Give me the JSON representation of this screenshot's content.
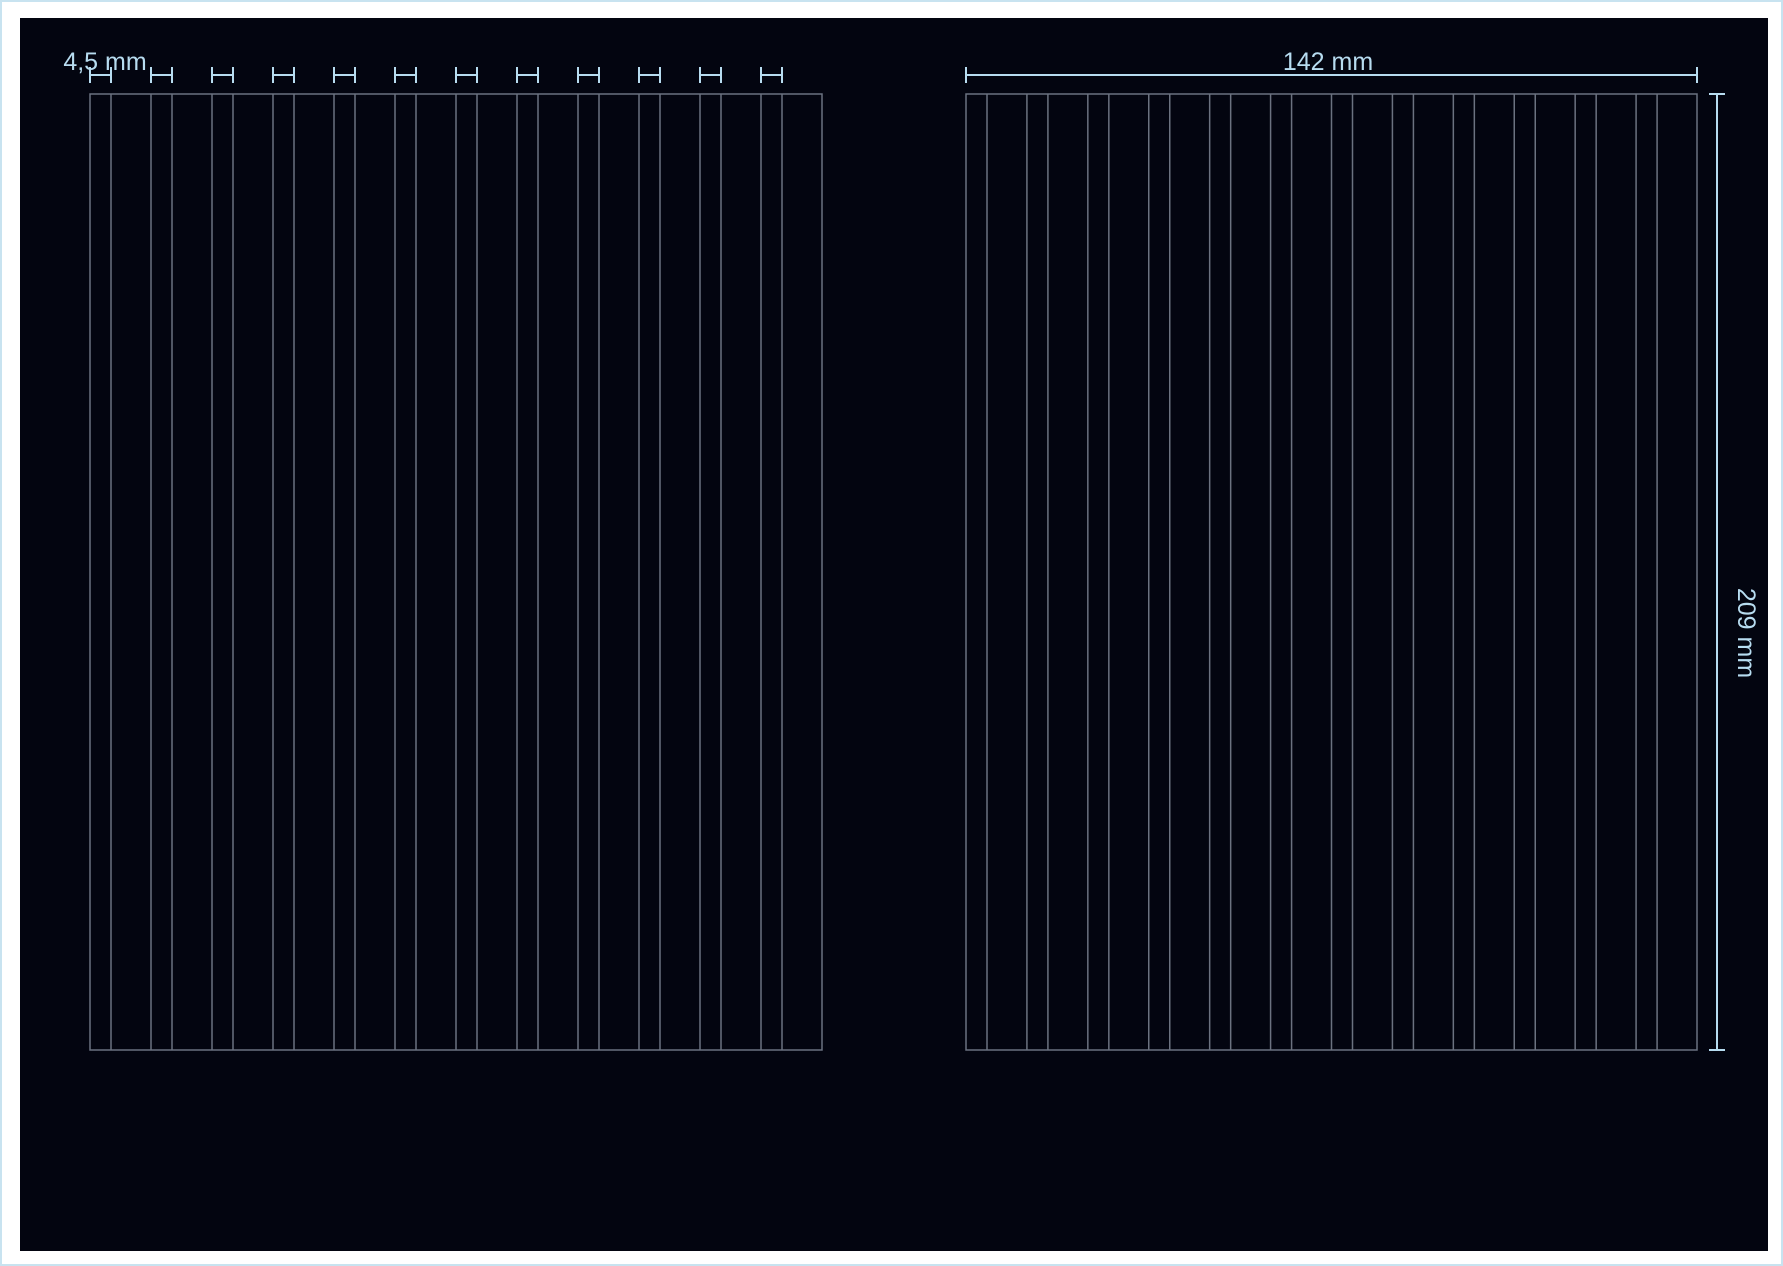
{
  "labels": {
    "column_width": "4,5 mm",
    "spread_width": "142 mm",
    "spread_height": "209 mm"
  },
  "grid": {
    "left_page_columns": 12,
    "right_page_columns": 12,
    "column_width_mm": 4.5,
    "page_width_mm": 142,
    "page_height_mm": 209
  },
  "colors": {
    "background": "#030510",
    "outer_frame": "#c8e3f0",
    "grid_line": "#6b7280",
    "dimension": "#b7dcf0"
  }
}
